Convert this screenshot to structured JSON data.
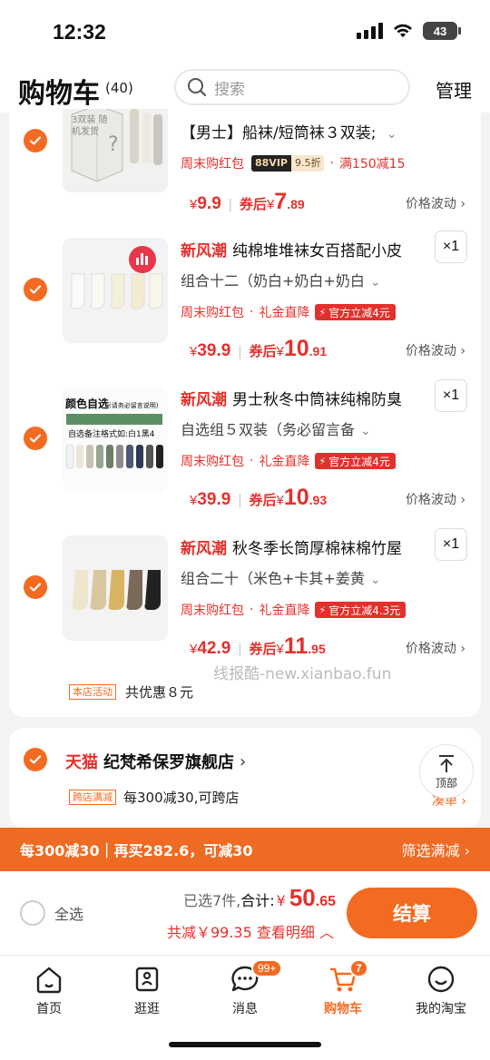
{
  "status_bar": {
    "time": "12:32",
    "battery": "43"
  },
  "header": {
    "title": "购物车",
    "count": "(40)",
    "search_placeholder": "搜索",
    "manage": "管理"
  },
  "items": [
    {
      "brand": "",
      "title": "【男士】船袜/短筒袜３双装;",
      "sku": "",
      "qty": "",
      "promo_text": "周末购红包",
      "vip_a": "88VIP",
      "vip_b": "9.5折",
      "promo_extra": "满150减15",
      "price_cur": "¥",
      "price": "9.9",
      "after_label": "券后",
      "after_cur": "¥",
      "after_int": "7",
      "after_dec": ".89",
      "wave": "价格波动",
      "thumb_text": "3双装 随机发货"
    },
    {
      "brand": "新风潮",
      "title": "纯棉堆堆袜女百搭配小皮",
      "sku": "组合十二（奶白+奶白+奶白",
      "qty": "×1",
      "promo_text": "周末购红包",
      "promo_gift": "礼金直降",
      "off_badge": "官方立减4元",
      "price_cur": "¥",
      "price": "39.9",
      "after_label": "券后",
      "after_cur": "¥",
      "after_int": "10",
      "after_dec": ".91",
      "wave": "价格波动"
    },
    {
      "brand": "新风潮",
      "title": "男士秋冬中筒袜纯棉防臭",
      "sku": "自选组５双装（务必留言备",
      "qty": "×1",
      "promo_text": "周末购红包",
      "promo_gift": "礼金直降",
      "off_badge": "官方立减4元",
      "price_cur": "¥",
      "price": "39.9",
      "after_label": "券后",
      "after_cur": "¥",
      "after_int": "10",
      "after_dec": ".93",
      "wave": "价格波动",
      "thumb_title": "颜色自选",
      "thumb_sub": "(请务必留言说明)",
      "thumb_line2": "自选备注格式如:白1黑4"
    },
    {
      "brand": "新风潮",
      "title": "秋冬季长筒厚棉袜棉竹屋",
      "sku": "组合二十（米色+卡其+姜黄",
      "qty": "×1",
      "promo_text": "周末购红包",
      "promo_gift": "礼金直降",
      "off_badge": "官方立减4.3元",
      "price_cur": "¥",
      "price": "42.9",
      "after_label": "券后",
      "after_cur": "¥",
      "after_int": "11",
      "after_dec": ".95",
      "wave": "价格波动"
    }
  ],
  "shop_activity": {
    "tag": "本店活动",
    "text": "共优惠８元"
  },
  "watermark": "线报酷-new.xianbao.fun",
  "store": {
    "tmall": "天猫",
    "name": "纪梵希保罗旗舰店",
    "promo_tag": "跨店满减",
    "promo_text": "每300减30,可跨店",
    "more": "凑单",
    "back_top": "顶部"
  },
  "promo_bar": {
    "left": "每300减30｜再买282.6，可减30",
    "right": "筛选满减"
  },
  "checkout": {
    "select_all": "全选",
    "selected": "已选7件,",
    "total_label": "合计:",
    "total_cur": "¥",
    "total_int": "50",
    "total_dec": ".65",
    "saved": "共减￥99.35 查看明细",
    "button": "结算"
  },
  "tabs": [
    {
      "label": "首页",
      "icon": "home-icon"
    },
    {
      "label": "逛逛",
      "icon": "stroll-icon"
    },
    {
      "label": "消息",
      "icon": "message-icon",
      "badge": "99+"
    },
    {
      "label": "购物车",
      "icon": "cart-icon",
      "badge": "7"
    },
    {
      "label": "我的淘宝",
      "icon": "profile-icon"
    }
  ],
  "colors": {
    "accent": "#f26b21",
    "price": "#e4302c",
    "promo_bar": "#ef6a23"
  }
}
